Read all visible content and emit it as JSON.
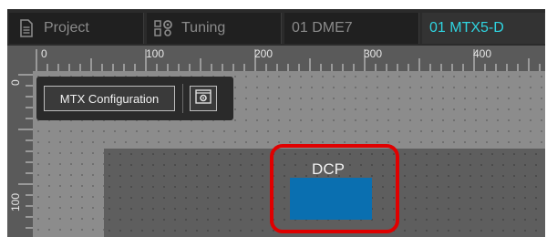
{
  "tabs": [
    {
      "label": "Project",
      "icon": "document-icon",
      "active": false
    },
    {
      "label": "Tuning",
      "icon": "tuning-icon",
      "active": false
    },
    {
      "label": "01 DME7",
      "icon": "",
      "active": false
    },
    {
      "label": "01 MTX5-D",
      "icon": "",
      "active": true
    }
  ],
  "ruler": {
    "horizontal_labels": [
      "0",
      "100",
      "200",
      "300",
      "400"
    ],
    "vertical_labels": [
      "0",
      "100"
    ]
  },
  "toolbar": {
    "mtx_configuration_label": "MTX Configuration",
    "config_icon": "gear-window-icon"
  },
  "device": {
    "label": "DCP",
    "color": "#0a6fb0",
    "highlight_color": "#e00000"
  },
  "colors": {
    "active_tab_text": "#2fd4e0"
  }
}
